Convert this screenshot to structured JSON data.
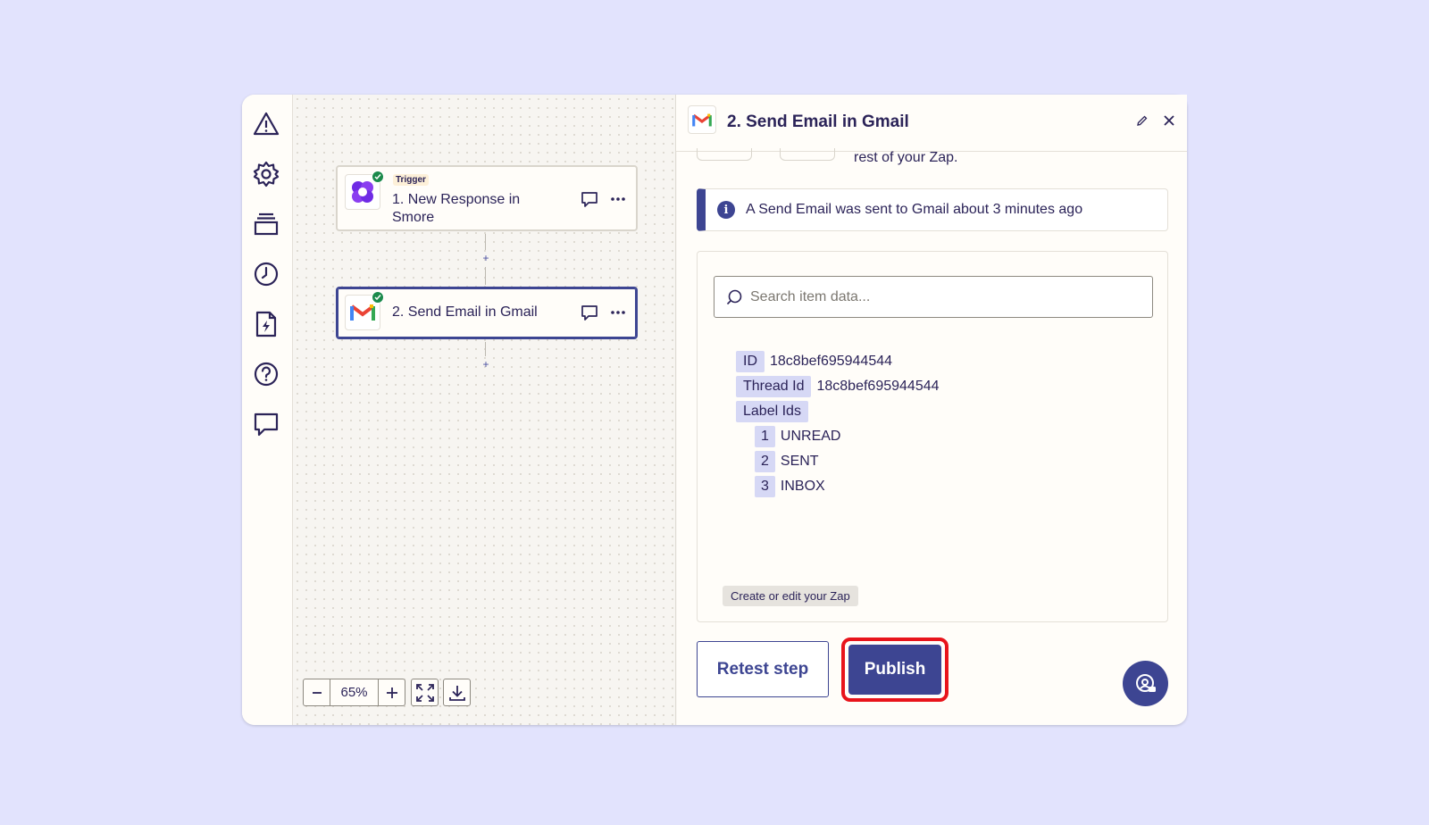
{
  "steps": [
    {
      "pill": "Trigger",
      "title_line1": "1. New Response in",
      "title_line2": "Smore",
      "icon": "smore-logo-icon"
    },
    {
      "title": "2. Send Email in Gmail",
      "icon": "gmail-logo-icon"
    }
  ],
  "zoom": {
    "value": "65%",
    "minus": "−",
    "plus": "+"
  },
  "panel": {
    "title": "2. Send Email in Gmail",
    "partial_text": "rest of your Zap.",
    "info_icon": "i",
    "info_text": "A Send Email was sent to Gmail about 3 minutes ago",
    "search_placeholder": "Search item data...",
    "fields": {
      "id_key": "ID",
      "id_val": "18c8bef695944544",
      "thread_key": "Thread Id",
      "thread_val": "18c8bef695944544",
      "labels_key": "Label Ids",
      "labels": [
        {
          "index": "1",
          "value": "UNREAD"
        },
        {
          "index": "2",
          "value": "SENT"
        },
        {
          "index": "3",
          "value": "INBOX"
        }
      ]
    },
    "tooltip": "Create or edit your Zap",
    "retest_label": "Retest step",
    "publish_label": "Publish"
  },
  "colors": {
    "accent": "#3d4592",
    "highlight": "#e8141b",
    "success": "#1b8a4b",
    "background": "#e2e3fd"
  }
}
